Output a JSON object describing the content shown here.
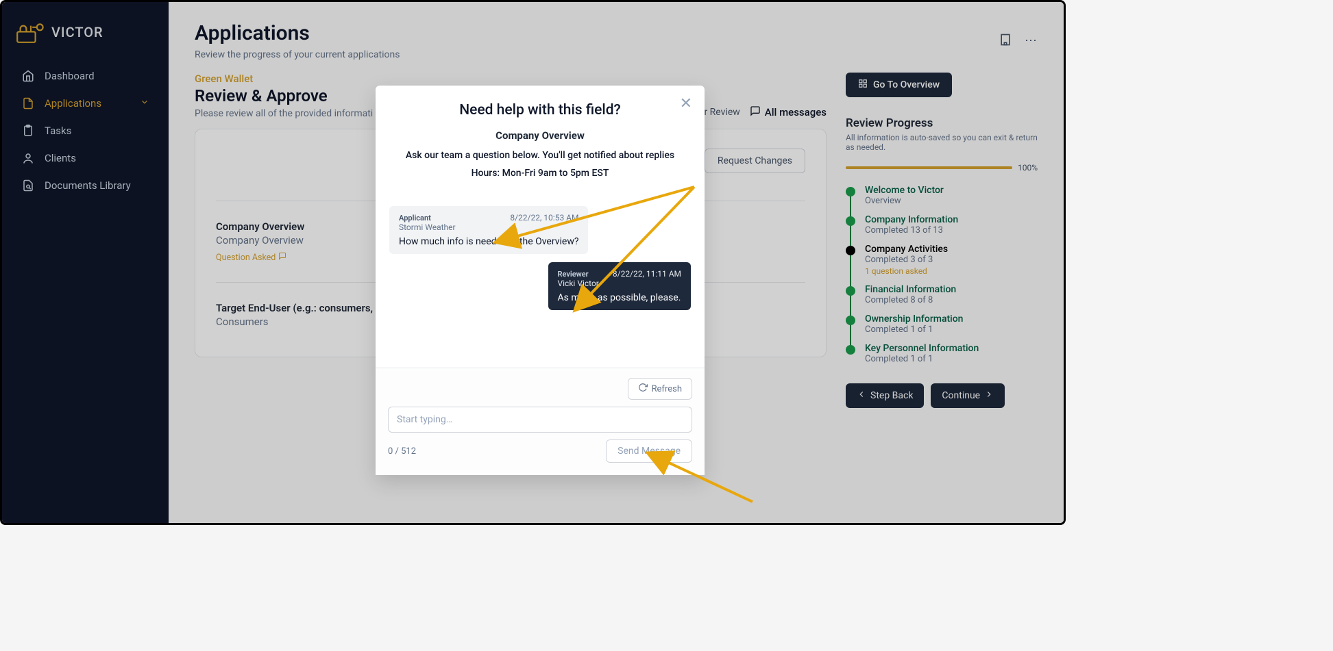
{
  "brand": {
    "name": "VICTOR"
  },
  "nav": {
    "dashboard": "Dashboard",
    "applications": "Applications",
    "tasks": "Tasks",
    "clients": "Clients",
    "documents": "Documents Library"
  },
  "header": {
    "title": "Applications",
    "subtitle": "Review the progress of your current applications"
  },
  "section": {
    "breadcrumb": "Green Wallet",
    "title": "Review & Approve",
    "desc": "Please review all of the provided informati",
    "status": "…der Review",
    "all_messages": "All messages",
    "go_overview": "Go To Overview",
    "request_changes": "Request Changes"
  },
  "fields": [
    {
      "label": "Company Overview",
      "value": "Company Overview",
      "question_asked": "Question Asked"
    },
    {
      "label": "Target End-User (e.g.: consumers, bus                                                              f cannabis (marijuana, merchants, etc.)",
      "value": "Consumers"
    }
  ],
  "right": {
    "progress_title": "Review Progress",
    "progress_desc": "All information is auto-saved so you can exit & return as needed.",
    "progress_pct": "100%",
    "steps": [
      {
        "name": "Welcome to Victor",
        "status": "Overview",
        "state": "done"
      },
      {
        "name": "Company Information",
        "status": "Completed 13 of 13",
        "state": "done"
      },
      {
        "name": "Company Activities",
        "status": "Completed 3 of 3",
        "note": "1 question asked",
        "state": "current"
      },
      {
        "name": "Financial Information",
        "status": "Completed 8 of 8",
        "state": "done"
      },
      {
        "name": "Ownership Information",
        "status": "Completed 1 of 1",
        "state": "done"
      },
      {
        "name": "Key Personnel Information",
        "status": "Completed 1 of 1",
        "state": "done"
      }
    ],
    "step_back": "Step Back",
    "continue": "Continue"
  },
  "modal": {
    "title": "Need help with this field?",
    "topic": "Company Overview",
    "sub1": "Ask our team a question below. You'll get notified about replies",
    "sub2": "Hours: Mon-Fri 9am to 5pm EST",
    "messages": [
      {
        "role": "Applicant",
        "name": "Stormi Weather",
        "time": "8/22/22, 10:53 AM",
        "body": "How much info is needed in the Overview?",
        "side": "applicant"
      },
      {
        "role": "Reviewer",
        "name": "Vicki Victor",
        "time": "8/22/22, 11:11 AM",
        "body": "As much as possible, please.",
        "side": "reviewer"
      }
    ],
    "refresh": "Refresh",
    "placeholder": "Start typing…",
    "counter": "0 / 512",
    "send": "Send Message"
  },
  "colors": {
    "accent": "#d4a02d",
    "green": "#15803d",
    "dark": "#0f172a"
  }
}
